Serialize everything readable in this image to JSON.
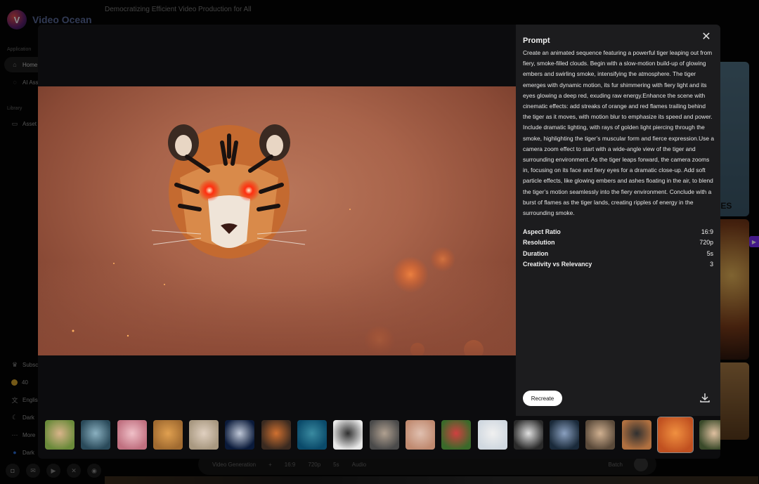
{
  "app": {
    "logo_text": "Video Ocean",
    "tagline": "Democratizing Efficient Video Production for All"
  },
  "sidebar": {
    "section_application": "Application",
    "section_library": "Library",
    "items": [
      {
        "label": "Home",
        "icon": "home-icon"
      },
      {
        "label": "AI Ass",
        "icon": "chat-icon"
      },
      {
        "label": "Asset",
        "icon": "folder-icon"
      }
    ],
    "bottom_items": [
      {
        "label": "Subsc",
        "icon": "crown-icon"
      },
      {
        "label": "40",
        "icon": "coin-icon"
      },
      {
        "label": "Englis",
        "icon": "translate-icon"
      },
      {
        "label": "Dark",
        "icon": "moon-icon"
      },
      {
        "label": "More",
        "icon": "more-icon"
      },
      {
        "label": "Dark",
        "icon": "dot-icon"
      }
    ]
  },
  "background_bar": {
    "mode": "Video Generation",
    "ratio": "16:9",
    "resolution": "720p",
    "duration": "5s",
    "audio": "Audio",
    "batch": "Batch"
  },
  "background_right": {
    "card_text": "ZES"
  },
  "modal": {
    "prompt_title": "Prompt",
    "prompt_text": "Create an animated sequence featuring a powerful tiger leaping out from fiery, smoke-filled clouds. Begin with a slow-motion build-up of glowing embers and swirling smoke, intensifying the atmosphere. The tiger emerges with dynamic motion, its fur shimmering with fiery light and its eyes glowing a deep red, exuding raw energy.Enhance the scene with cinematic effects: add streaks of orange and red flames trailing behind the tiger as it moves, with motion blur to emphasize its speed and power. Include dramatic lighting, with rays of golden light piercing through the smoke, highlighting the tiger’s muscular form and fierce expression.Use a camera zoom effect to start with a wide-angle view of the tiger and surrounding environment. As the tiger leaps forward, the camera zooms in, focusing on its face and fiery eyes for a dramatic close-up. Add soft particle effects, like glowing embers and ashes floating in the air, to blend the tiger’s motion seamlessly into the fiery environment. Conclude with a burst of flames as the tiger lands, creating ripples of energy in the surrounding smoke.",
    "params": [
      {
        "label": "Aspect Ratio",
        "value": "16:9"
      },
      {
        "label": "Resolution",
        "value": "720p"
      },
      {
        "label": "Duration",
        "value": "5s"
      },
      {
        "label": "Creativity vs Relevancy",
        "value": "3"
      }
    ],
    "recreate_label": "Recreate",
    "thumbnails": [
      {
        "name": "woman-in-field",
        "colors": [
          "#6a8a3a",
          "#d9b48a"
        ]
      },
      {
        "name": "goggles-portrait",
        "colors": [
          "#2a4a5a",
          "#8ab0c0"
        ]
      },
      {
        "name": "bubblegum-girl",
        "colors": [
          "#c07080",
          "#f0c0c8"
        ]
      },
      {
        "name": "cat-reading",
        "colors": [
          "#a06a30",
          "#e0a050"
        ]
      },
      {
        "name": "rabbit",
        "colors": [
          "#a89880",
          "#e0d0c0"
        ]
      },
      {
        "name": "astronaut-moon",
        "colors": [
          "#0a1a3a",
          "#c0c8d8"
        ]
      },
      {
        "name": "cat-fire",
        "colors": [
          "#3a2a20",
          "#d07030"
        ]
      },
      {
        "name": "underwater-ship",
        "colors": [
          "#0a4a6a",
          "#3a8aa0"
        ]
      },
      {
        "name": "penguin",
        "colors": [
          "#e8e8e8",
          "#303030"
        ]
      },
      {
        "name": "man-portrait",
        "colors": [
          "#4a4a4a",
          "#b0a090"
        ]
      },
      {
        "name": "woman-anime",
        "colors": [
          "#c08a70",
          "#e0c0b0"
        ]
      },
      {
        "name": "watermelon",
        "colors": [
          "#3a6a2a",
          "#d04040"
        ]
      },
      {
        "name": "white-hair-girl",
        "colors": [
          "#d0d8e0",
          "#f0f0f0"
        ]
      },
      {
        "name": "panda",
        "colors": [
          "#2a2a2a",
          "#e0e0e0"
        ]
      },
      {
        "name": "anime-girl-dark",
        "colors": [
          "#1a2a3a",
          "#8aa0c0"
        ]
      },
      {
        "name": "cat-sitting",
        "colors": [
          "#5a4a3a",
          "#d0b090"
        ]
      },
      {
        "name": "car",
        "colors": [
          "#b07040",
          "#303030"
        ]
      },
      {
        "name": "tiger-fire",
        "colors": [
          "#c05020",
          "#f09040"
        ],
        "selected": true
      },
      {
        "name": "girl-flowers",
        "colors": [
          "#3a4a2a",
          "#e0c0a0"
        ]
      }
    ]
  }
}
